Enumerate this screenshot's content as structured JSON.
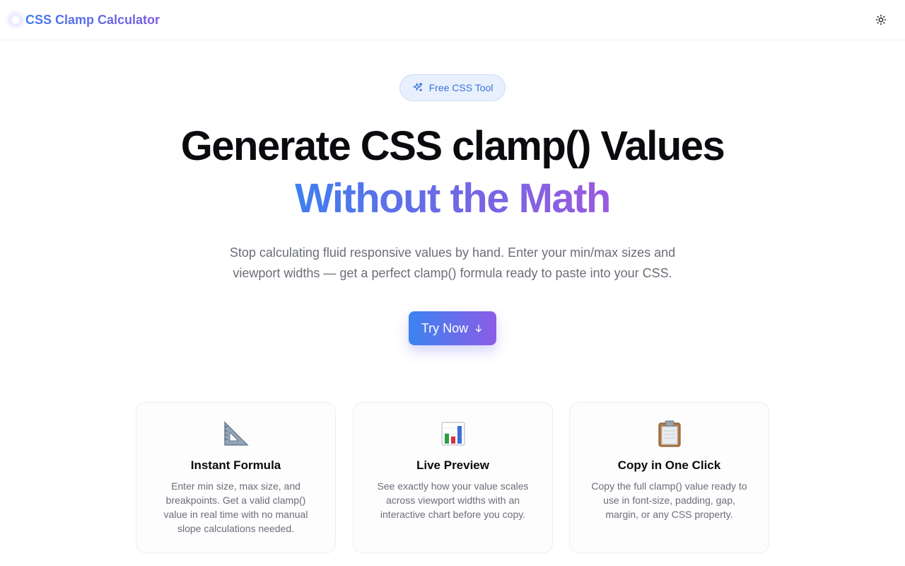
{
  "header": {
    "brand": "CSS Clamp Calculator",
    "theme_toggle_icon": "sun-icon"
  },
  "hero": {
    "badge": "Free CSS Tool",
    "badge_icon": "sparkles-icon",
    "title_line1": "Generate CSS clamp() Values",
    "title_line2": "Without the Math",
    "subtitle": "Stop calculating fluid responsive values by hand. Enter your min/max sizes and viewport widths — get a perfect clamp() formula ready to paste into your CSS.",
    "cta_label": "Try Now",
    "cta_icon": "arrow-down-icon"
  },
  "colors": {
    "accent_blue": "#3e7ff0",
    "accent_purple": "#8b5ce6",
    "badge_bg": "#e9f0fd",
    "muted_text": "#6b6e78"
  },
  "features": [
    {
      "icon": "triangular-ruler-icon",
      "title": "Instant Formula",
      "description": "Enter min size, max size, and breakpoints. Get a valid clamp() value in real time with no manual slope calculations needed."
    },
    {
      "icon": "bar-chart-icon",
      "title": "Live Preview",
      "description": "See exactly how your value scales across viewport widths with an interactive chart before you copy."
    },
    {
      "icon": "clipboard-icon",
      "title": "Copy in One Click",
      "description": "Copy the full clamp() value ready to use in font-size, padding, gap, margin, or any CSS property."
    }
  ]
}
